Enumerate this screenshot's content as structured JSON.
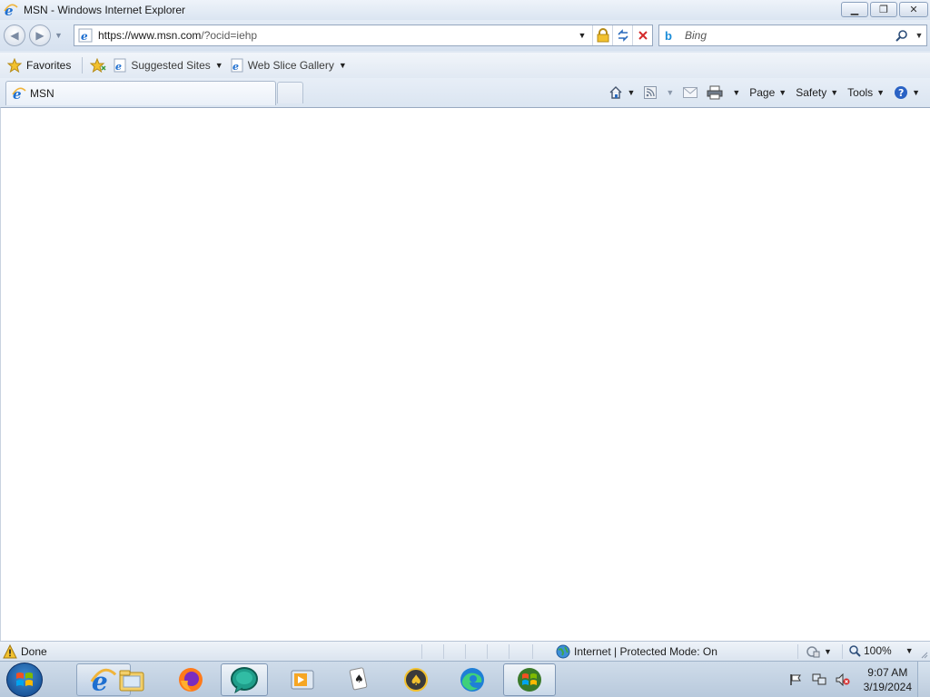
{
  "window": {
    "title": "MSN - Windows Internet Explorer"
  },
  "address": {
    "url_host": "https://www.msn.com",
    "url_path": "/?ocid=iehp"
  },
  "search": {
    "placeholder": "Bing"
  },
  "favorites_bar": {
    "favorites_label": "Favorites",
    "links": [
      {
        "label": "Suggested Sites"
      },
      {
        "label": "Web Slice Gallery"
      }
    ]
  },
  "tab": {
    "label": "MSN"
  },
  "command_bar": {
    "page_label": "Page",
    "safety_label": "Safety",
    "tools_label": "Tools"
  },
  "status": {
    "text": "Done",
    "zone": "Internet | Protected Mode: On",
    "zoom": "100%"
  },
  "taskbar": {
    "time": "9:07 AM",
    "date": "3/19/2024"
  },
  "colors": {
    "ie_blue": "#1e6fd0",
    "ie_gold": "#f0b43a"
  }
}
